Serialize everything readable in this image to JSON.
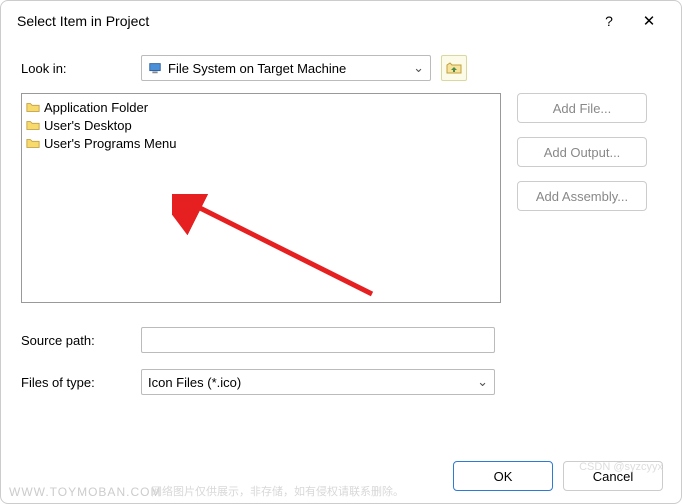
{
  "dialog": {
    "title": "Select Item in Project"
  },
  "lookin": {
    "label": "Look in:",
    "value": "File System on Target Machine"
  },
  "folders": [
    "Application Folder",
    "User's Desktop",
    "User's Programs Menu"
  ],
  "buttons": {
    "addFile": "Add File...",
    "addOutput": "Add Output...",
    "addAssembly": "Add Assembly..."
  },
  "sourcePath": {
    "label": "Source path:",
    "value": ""
  },
  "filesOfType": {
    "label": "Files of type:",
    "value": "Icon Files (*.ico)"
  },
  "footer": {
    "ok": "OK",
    "cancel": "Cancel"
  },
  "watermark": {
    "site": "WWW.TOYMOBAN.COM",
    "note": "网络图片仅供展示，非存储，如有侵权请联系删除。",
    "csdn": "CSDN @syzcyyx"
  }
}
